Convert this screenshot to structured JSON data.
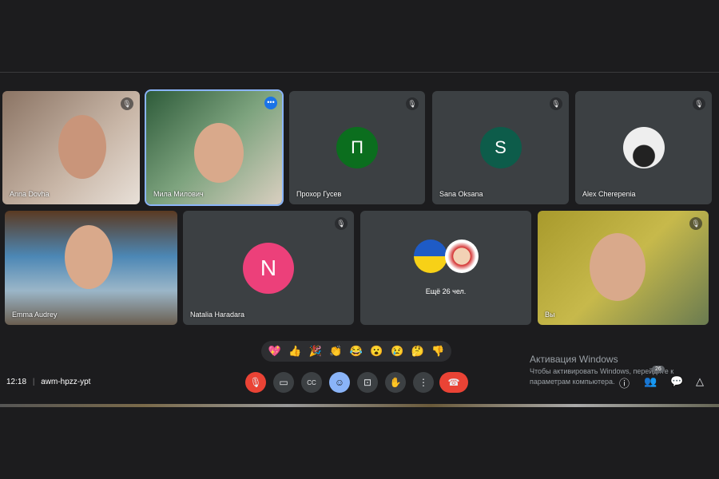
{
  "participants_row1": [
    {
      "name": "Anna Dovha",
      "type": "video"
    },
    {
      "name": "Мила Милович",
      "type": "video",
      "active": true
    },
    {
      "name": "Прохор Гусев",
      "type": "avatar",
      "initial": "П",
      "color": "#0b6e1e"
    },
    {
      "name": "Sana Oksana",
      "type": "avatar",
      "initial": "S",
      "color": "#0d5c4a"
    },
    {
      "name": "Alex Cherepenia",
      "type": "photo"
    }
  ],
  "participants_row2": [
    {
      "name": "Emma Audrey",
      "type": "video"
    },
    {
      "name": "Natalia Haradara",
      "type": "avatar",
      "initial": "N",
      "color": "#ec407a"
    },
    {
      "others": "Ещё 26 чел."
    },
    {
      "name": "Вы",
      "type": "video"
    }
  ],
  "reactions": [
    "💖",
    "👍",
    "🎉",
    "👏",
    "😂",
    "😮",
    "😢",
    "🤔",
    "👎"
  ],
  "meeting": {
    "time": "12:18",
    "code": "awm-hpzz-ypt"
  },
  "controls": [
    "mic-off",
    "camera",
    "captions",
    "emoji",
    "present",
    "raise-hand",
    "more",
    "leave"
  ],
  "people_count": "26",
  "watermark": {
    "title": "Активация Windows",
    "line1": "Чтобы активировать Windows, перейдите к",
    "line2": "параметрам компьютера."
  }
}
